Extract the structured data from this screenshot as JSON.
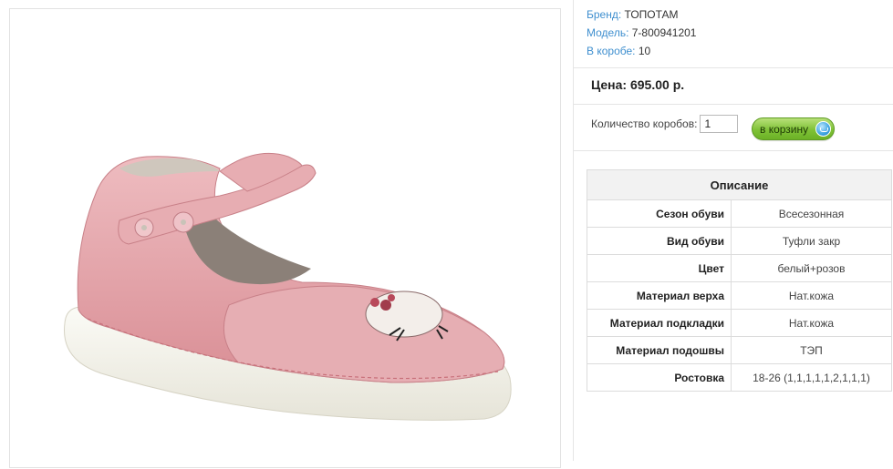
{
  "meta": {
    "brand_label": "Бренд:",
    "brand_value": "ТОПОТАМ",
    "model_label": "Модель:",
    "model_value": "7-800941201",
    "box_label": "В коробе:",
    "box_value": "10"
  },
  "price": "Цена: 695.00 р.",
  "order": {
    "qty_label": "Количество коробов:",
    "qty_value": "1",
    "cart_button": "в корзину"
  },
  "specs": {
    "title": "Описание",
    "rows": [
      {
        "key": "Сезон обуви",
        "value": "Всесезонная"
      },
      {
        "key": "Вид обуви",
        "value": "Туфли закр"
      },
      {
        "key": "Цвет",
        "value": "белый+розов"
      },
      {
        "key": "Материал верха",
        "value": "Нат.кожа"
      },
      {
        "key": "Материал подкладки",
        "value": "Нат.кожа"
      },
      {
        "key": "Материал подошвы",
        "value": "ТЭП"
      },
      {
        "key": "Ростовка",
        "value": "18-26 (1,1,1,1,1,2,1,1,1)"
      }
    ]
  },
  "colors": {
    "link": "#3f8fcf",
    "button_green": "#7fc237",
    "shoe_pink": "#e3a3a8"
  },
  "icons": {
    "cart": "basket-icon"
  }
}
